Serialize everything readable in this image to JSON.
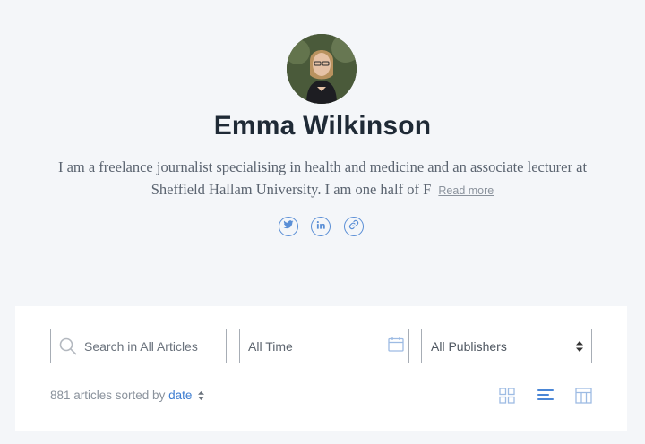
{
  "profile": {
    "name": "Emma Wilkinson",
    "bio": "I am a freelance journalist specialising in health and medicine and an associate lecturer at Sheffield Hallam University. I am one half of F",
    "read_more": "Read more",
    "socials": [
      "twitter-icon",
      "linkedin-icon",
      "link-icon"
    ]
  },
  "filters": {
    "search_placeholder": "Search in All Articles",
    "time": "All Time",
    "publishers": "All Publishers"
  },
  "listing": {
    "count_text": "881 articles sorted by",
    "sort_value": "date"
  },
  "colors": {
    "accent": "#5b8fd6",
    "background": "#f4f6f9",
    "name": "#1f2a36"
  }
}
